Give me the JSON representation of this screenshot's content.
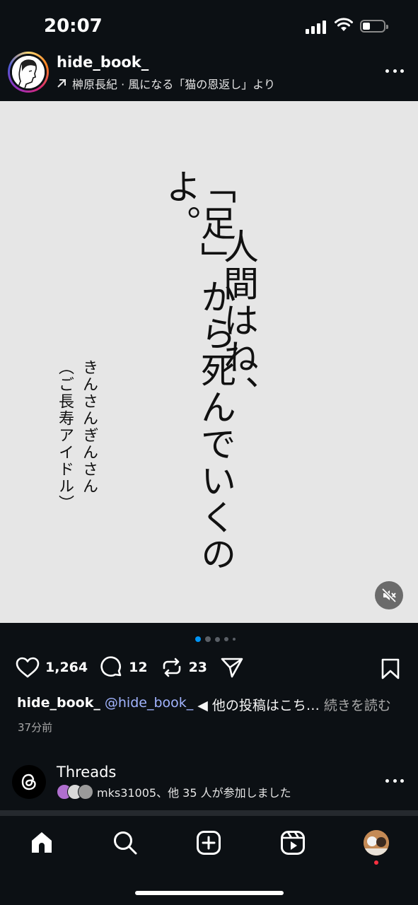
{
  "status_bar": {
    "time": "20:07",
    "battery_level": 0.35
  },
  "post": {
    "username": "hide_book_",
    "attribution": "榊原長紀 · 風になる「猫の恩返し」より",
    "image_text": {
      "line1": "人間はね、",
      "line2": "「足」から死んでいくのよ。",
      "speaker": "きんさんぎんさん",
      "speaker_note": "（ご長寿アイドル）"
    },
    "carousel": {
      "count": 5,
      "active_index": 0
    },
    "likes": "1,264",
    "comments": "12",
    "reposts": "23",
    "caption": {
      "username": "hide_book_",
      "mention": "@hide_book_",
      "text": "◀ 他の投稿はこち…",
      "more": "続きを読む"
    },
    "posted_ago": "37分前"
  },
  "threads": {
    "title": "Threads",
    "joined_text": "mks31005、他 35 人が参加しました"
  },
  "colors": {
    "background": "#0c1014",
    "image_background": "#e6e6e6",
    "mention": "#a2b4ff",
    "notification_dot": "#ff3040",
    "active_dot": "#0095f6"
  },
  "icons": [
    "heart-icon",
    "comment-icon",
    "repost-icon",
    "share-icon",
    "bookmark-icon",
    "mute-icon",
    "home-icon",
    "search-icon",
    "create-icon",
    "reels-icon",
    "profile-avatar"
  ]
}
